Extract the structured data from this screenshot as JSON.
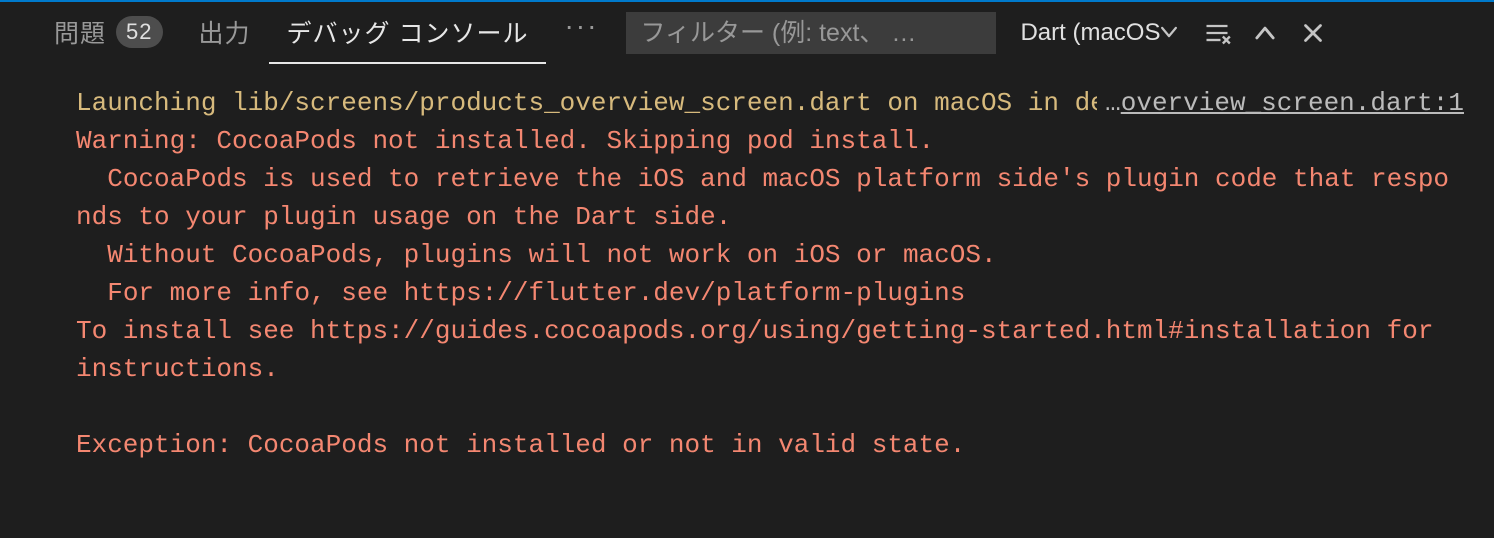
{
  "tabs": {
    "problems": {
      "label": "問題",
      "badge": "52"
    },
    "output": {
      "label": "出力"
    },
    "debug": {
      "label": "デバッグ コンソール"
    }
  },
  "overflow_label": "···",
  "filter": {
    "placeholder": "フィルター (例: text、 …"
  },
  "session_dropdown": {
    "label": "Dart (macOS"
  },
  "file_link": "overview_screen.dart:1",
  "console": {
    "launch": "Launching lib/screens/products_overview_screen.dart on macOS in debug mode...",
    "error": "Warning: CocoaPods not installed. Skipping pod install.\n  CocoaPods is used to retrieve the iOS and macOS platform side's plugin code that responds to your plugin usage on the Dart side.\n  Without CocoaPods, plugins will not work on iOS or macOS.\n  For more info, see https://flutter.dev/platform-plugins\nTo install see https://guides.cocoapods.org/using/getting-started.html#installation for instructions.\n\nException: CocoaPods not installed or not in valid state."
  }
}
